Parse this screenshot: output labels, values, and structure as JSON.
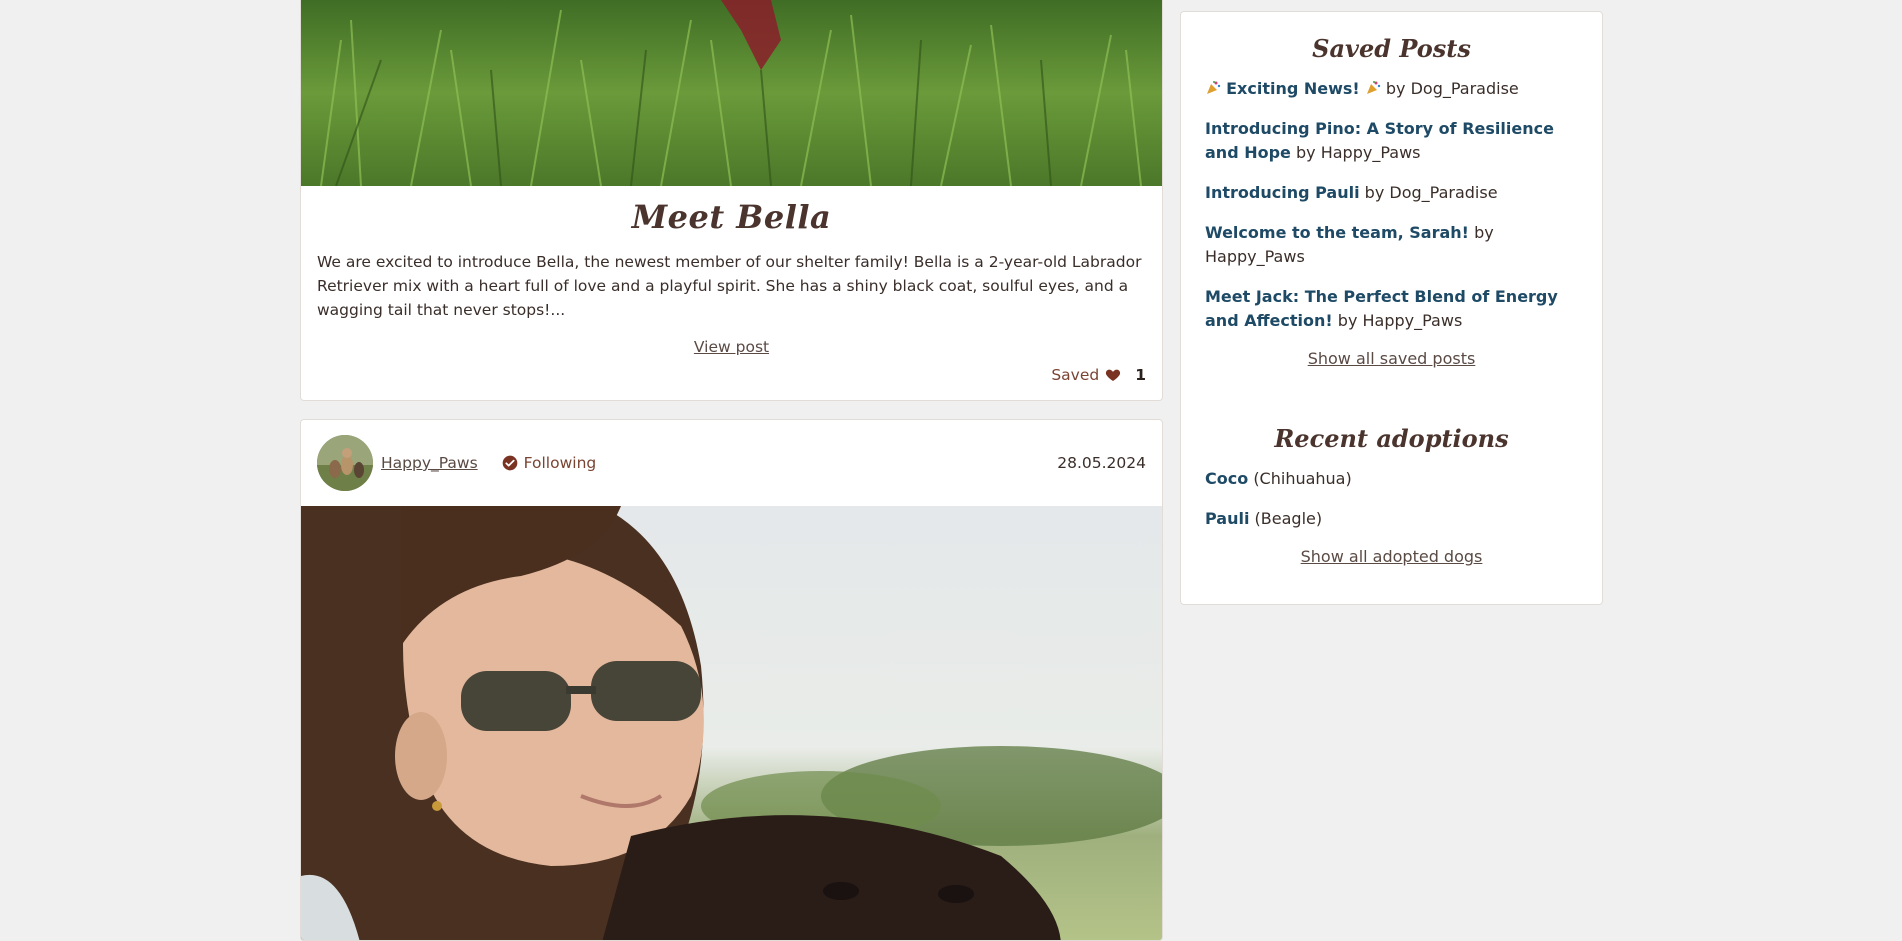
{
  "post1": {
    "title": "Meet Bella",
    "excerpt": "We are excited to introduce Bella, the newest member of our shelter family! Bella is a 2-year-old Labrador Retriever mix with a heart full of love and a playful spirit. She has a shiny black coat, soulful eyes, and a wagging tail that never stops!...",
    "view_link": "View post",
    "saved_label": "Saved",
    "saved_count": "1",
    "image_icon": "grass-photo"
  },
  "post2": {
    "author": "Happy_Paws",
    "following_label": "Following",
    "date": "28.05.2024",
    "image_icon": "woman-with-dog-photo"
  },
  "sidebar": {
    "saved_heading": "Saved Posts",
    "saved_posts": [
      {
        "title": "Exciting News!",
        "by": "by Dog_Paradise"
      },
      {
        "title": "Introducing Pino: A Story of Resilience and Hope",
        "by": "by Happy_Paws"
      },
      {
        "title": "Introducing Pauli",
        "by": "by Dog_Paradise"
      },
      {
        "title": "Welcome to the team, Sarah!",
        "by": "by Happy_Paws"
      },
      {
        "title": "Meet Jack: The Perfect Blend of Energy and Affection!",
        "by": "by Happy_Paws"
      }
    ],
    "show_saved": "Show all saved posts",
    "adoptions_heading": "Recent adoptions",
    "adoptions": [
      {
        "name": "Coco",
        "breed": "(Chihuahua)"
      },
      {
        "name": "Pauli",
        "breed": "(Beagle)"
      }
    ],
    "show_adopted": "Show all adopted dogs"
  },
  "colors": {
    "background": "#f0f0f0",
    "link_blue": "#1e4a66",
    "accent_brown": "#7a4433",
    "heading": "#4a342d"
  }
}
